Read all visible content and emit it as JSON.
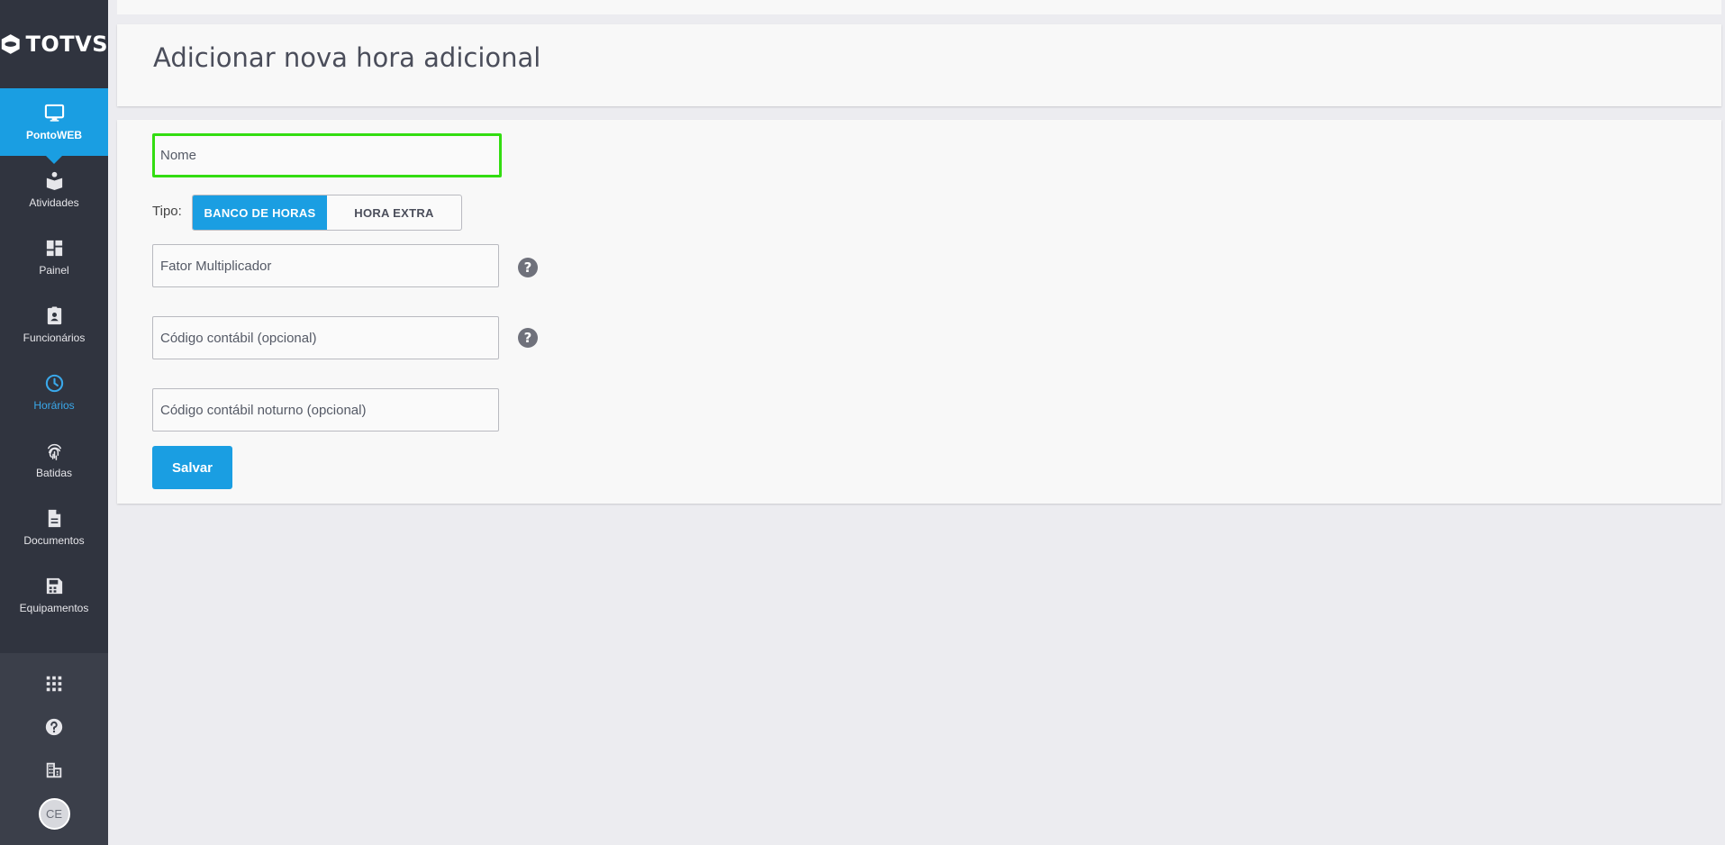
{
  "brand": {
    "name": "TOTVS"
  },
  "sidebar": {
    "items": [
      {
        "label": "PontoWEB",
        "icon": "monitor-icon",
        "state": "active"
      },
      {
        "label": "Atividades",
        "icon": "activities-icon",
        "state": ""
      },
      {
        "label": "Painel",
        "icon": "dashboard-icon",
        "state": ""
      },
      {
        "label": "Funcionários",
        "icon": "badge-icon",
        "state": ""
      },
      {
        "label": "Horários",
        "icon": "clock-icon",
        "state": "current"
      },
      {
        "label": "Batidas",
        "icon": "fingerprint-icon",
        "state": ""
      },
      {
        "label": "Documentos",
        "icon": "document-icon",
        "state": ""
      },
      {
        "label": "Equipamentos",
        "icon": "device-icon",
        "state": ""
      }
    ],
    "bottom": {
      "apps_icon": "apps-grid-icon",
      "help_icon": "help-icon",
      "company_icon": "building-icon",
      "avatar_initials": "CE"
    }
  },
  "page": {
    "title": "Adicionar nova hora adicional"
  },
  "form": {
    "nome": {
      "placeholder": "Nome",
      "value": ""
    },
    "tipo": {
      "label": "Tipo:",
      "options": [
        "BANCO DE HORAS",
        "HORA EXTRA"
      ],
      "selected": "BANCO DE HORAS"
    },
    "fator": {
      "placeholder": "Fator Multiplicador",
      "value": ""
    },
    "codigo_contabil": {
      "placeholder": "Código contábil (opcional)",
      "value": ""
    },
    "codigo_noturno": {
      "placeholder": "Código contábil noturno (opcional)",
      "value": ""
    },
    "help_symbol": "?",
    "save_label": "Salvar"
  },
  "colors": {
    "accent": "#1a9ee2",
    "sidebar_bg": "#30343f",
    "focus_border": "#33dd11"
  }
}
